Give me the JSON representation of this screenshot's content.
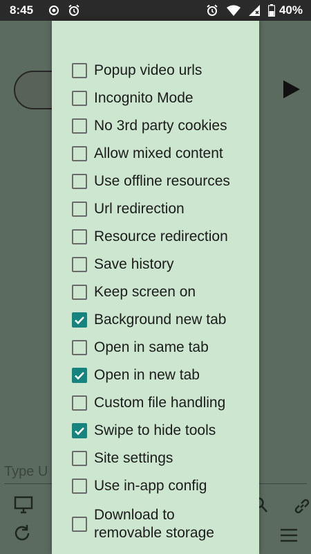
{
  "status_bar": {
    "time": "8:45",
    "battery": "40%",
    "left_icons": [
      "record-icon",
      "alarm-icon"
    ],
    "right_icons": [
      "alarm-icon",
      "wifi-icon",
      "signal-icon",
      "battery-icon"
    ]
  },
  "background": {
    "url_placeholder": "Type U",
    "icons": [
      "desktop-icon",
      "refresh-icon",
      "search-icon",
      "link-icon",
      "menu-icon"
    ]
  },
  "menu": {
    "accent_color": "#16837f",
    "items": [
      {
        "label": "Popup video urls",
        "checked": false
      },
      {
        "label": "Incognito Mode",
        "checked": false
      },
      {
        "label": "No 3rd party cookies",
        "checked": false
      },
      {
        "label": "Allow mixed content",
        "checked": false
      },
      {
        "label": "Use offline resources",
        "checked": false
      },
      {
        "label": "Url redirection",
        "checked": false
      },
      {
        "label": "Resource redirection",
        "checked": false
      },
      {
        "label": "Save history",
        "checked": false
      },
      {
        "label": "Keep screen on",
        "checked": false
      },
      {
        "label": "Background new tab",
        "checked": true
      },
      {
        "label": "Open in same tab",
        "checked": false
      },
      {
        "label": "Open in new tab",
        "checked": true
      },
      {
        "label": "Custom file handling",
        "checked": false
      },
      {
        "label": "Swipe to hide tools",
        "checked": true
      },
      {
        "label": "Site settings",
        "checked": false
      },
      {
        "label": "Use in-app config",
        "checked": false
      }
    ],
    "last_item": {
      "line1": "Download to",
      "line2": "removable storage",
      "checked": false
    }
  }
}
